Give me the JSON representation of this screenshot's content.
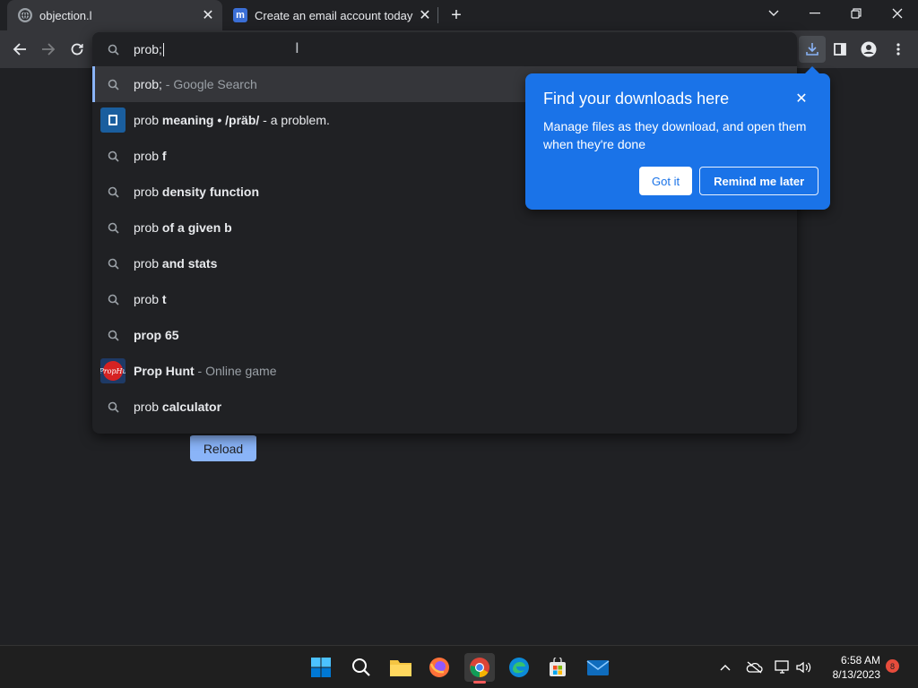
{
  "tabs": [
    {
      "title": "objection.l",
      "favicon": "globe-icon",
      "active": true
    },
    {
      "title": "Create an email account today at",
      "favicon": "m-logo-icon",
      "active": false
    }
  ],
  "omnibox": {
    "query": "prob;",
    "suggestions": [
      {
        "icon": "search-icon",
        "prefix": "prob;",
        "bold": "",
        "suffix": " - Google Search",
        "selected": true
      },
      {
        "icon": "dictionary-icon",
        "prefix": "prob ",
        "bold": "meaning • /präb/",
        "suffix": " - a problem."
      },
      {
        "icon": "search-icon",
        "prefix": "prob ",
        "bold": "f",
        "suffix": ""
      },
      {
        "icon": "search-icon",
        "prefix": "prob ",
        "bold": "density function",
        "suffix": ""
      },
      {
        "icon": "search-icon",
        "prefix": "prob ",
        "bold": "of a given b",
        "suffix": ""
      },
      {
        "icon": "search-icon",
        "prefix": "prob ",
        "bold": "and stats",
        "suffix": ""
      },
      {
        "icon": "search-icon",
        "prefix": "prob ",
        "bold": "t",
        "suffix": ""
      },
      {
        "icon": "search-icon",
        "prefix": "",
        "bold": "prop 65",
        "suffix": ""
      },
      {
        "icon": "prophunt-icon",
        "prefix": "",
        "bold": "Prop Hunt",
        "suffix": " - Online game"
      },
      {
        "icon": "search-icon",
        "prefix": "prob ",
        "bold": "calculator",
        "suffix": ""
      }
    ]
  },
  "page": {
    "reload_label": "Reload"
  },
  "downloads_bubble": {
    "title": "Find your downloads here",
    "body": "Manage files as they download, and open them when they're done",
    "got_it": "Got it",
    "remind_later": "Remind me later"
  },
  "taskbar": {
    "time": "6:58 AM",
    "date": "8/13/2023",
    "notification_count": "8"
  },
  "colors": {
    "accent": "#1a73e8",
    "reload": "#8ab4f8",
    "background": "#202124"
  }
}
